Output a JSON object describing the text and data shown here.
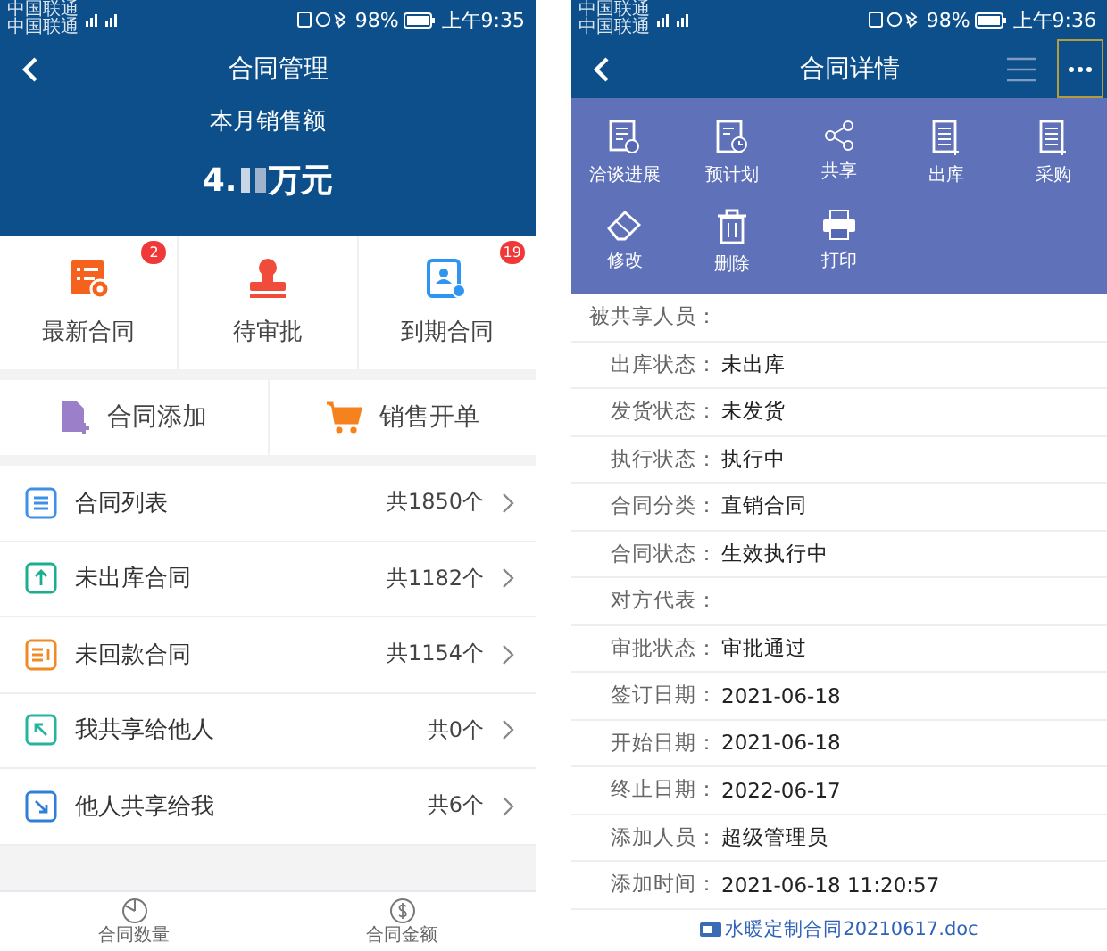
{
  "left_screen": {
    "status_bar": {
      "carriers": [
        "中国联通",
        "中国联通"
      ],
      "battery": "98%",
      "time": "上午9:35"
    },
    "header": {
      "title": "合同管理"
    },
    "summary": {
      "label": "本月销售额",
      "amount_prefix": "4.",
      "unit": "万元"
    },
    "tiles": [
      {
        "label": "最新合同",
        "badge": "2"
      },
      {
        "label": "待审批"
      },
      {
        "label": "到期合同",
        "badge": "19"
      }
    ],
    "actions": [
      {
        "label": "合同添加"
      },
      {
        "label": "销售开单"
      }
    ],
    "list": [
      {
        "label": "合同列表",
        "count": "共1850个",
        "color": "#3d8fe8"
      },
      {
        "label": "未出库合同",
        "count": "共1182个",
        "color": "#1aae8c"
      },
      {
        "label": "未回款合同",
        "count": "共1154个",
        "color": "#f08a24"
      },
      {
        "label": "我共享给他人",
        "count": "共0个",
        "color": "#26b3a0"
      },
      {
        "label": "他人共享给我",
        "count": "共6个",
        "color": "#2f7fd8"
      }
    ],
    "bottom_nav": [
      {
        "label": "合同数量"
      },
      {
        "label": "合同金额"
      }
    ]
  },
  "right_screen": {
    "status_bar": {
      "carriers": [
        "中国联通",
        "中国联通"
      ],
      "battery": "98%",
      "time": "上午9:36"
    },
    "header": {
      "title": "合同详情",
      "more_active": true
    },
    "menu": [
      {
        "label": "洽谈进展"
      },
      {
        "label": "预计划"
      },
      {
        "label": "共享"
      },
      {
        "label": "出库"
      },
      {
        "label": "采购"
      },
      {
        "label": "修改"
      },
      {
        "label": "删除"
      },
      {
        "label": "打印"
      }
    ],
    "fields": [
      {
        "label": "被共享人员："
      },
      {
        "label": "出库状态：",
        "value": "未出库"
      },
      {
        "label": "发货状态：",
        "value": "未发货"
      },
      {
        "label": "执行状态：",
        "value": "执行中"
      },
      {
        "label": "合同分类：",
        "value": "直销合同"
      },
      {
        "label": "合同状态：",
        "value": "生效执行中"
      },
      {
        "label": "对方代表："
      },
      {
        "label": "审批状态：",
        "value": "审批通过"
      },
      {
        "label": "签订日期：",
        "value": "2021-06-18"
      },
      {
        "label": "开始日期：",
        "value": "2021-06-18"
      },
      {
        "label": "终止日期：",
        "value": "2022-06-17"
      },
      {
        "label": "添加人员：",
        "value": "超级管理员"
      },
      {
        "label": "添加时间：",
        "value": "2021-06-18 11:20:57"
      }
    ],
    "attachment": "水暖定制合同20210617.doc"
  }
}
